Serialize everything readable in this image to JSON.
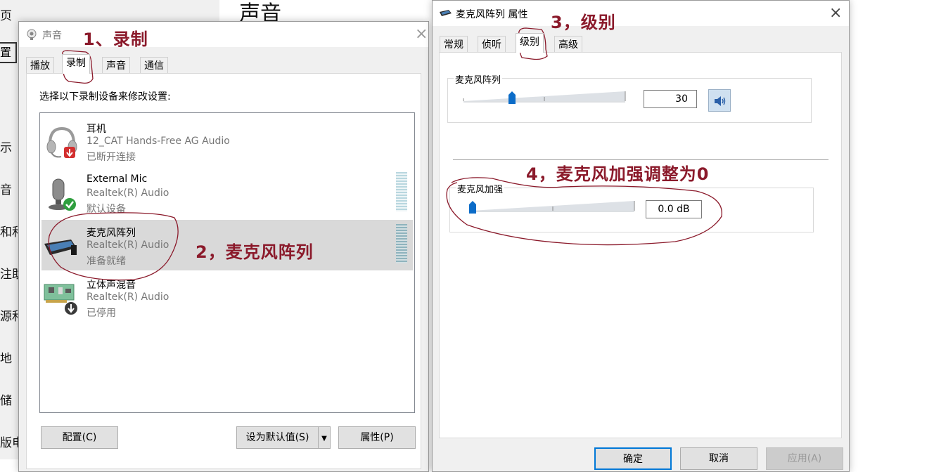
{
  "background": {
    "title": "声音",
    "fragments": [
      "页",
      "置",
      "示",
      "音",
      "和和",
      "注助",
      "源和",
      "地",
      "储",
      "版电"
    ]
  },
  "sound_dialog": {
    "title": "声音",
    "tabs": [
      "播放",
      "录制",
      "声音",
      "通信"
    ],
    "active_tab": 1,
    "instruction": "选择以下录制设备来修改设置:",
    "devices": [
      {
        "name": "耳机",
        "driver": "12_CAT Hands-Free AG Audio",
        "status": "已断开连接"
      },
      {
        "name": "External Mic",
        "driver": "Realtek(R) Audio",
        "status": "默认设备"
      },
      {
        "name": "麦克风阵列",
        "driver": "Realtek(R) Audio",
        "status": "准备就绪"
      },
      {
        "name": "立体声混音",
        "driver": "Realtek(R) Audio",
        "status": "已停用"
      }
    ],
    "selected_device": 2,
    "buttons": {
      "configure": "配置(C)",
      "set_default": "设为默认值(S)",
      "properties": "属性(P)"
    }
  },
  "props_dialog": {
    "title": "麦克风阵列 属性",
    "tabs": [
      "常规",
      "侦听",
      "级别",
      "高级"
    ],
    "active_tab": 2,
    "mic_array": {
      "label": "麦克风阵列",
      "value": "30",
      "level": 30
    },
    "mic_boost": {
      "label": "麦克风加强",
      "value": "0.0 dB",
      "level": 0
    },
    "buttons": {
      "ok": "确定",
      "cancel": "取消",
      "apply": "应用(A)"
    }
  },
  "annotations": {
    "step1": "1、录制",
    "step2": "2，麦克风阵列",
    "step3": "3，级别",
    "step4": "4，麦克风加强调整为0"
  },
  "colors": {
    "annotation": "#8b1a2b",
    "slider_thumb": "#0b6cc8",
    "selected_row": "#d9d9d9",
    "ok_border": "#0078d7"
  }
}
